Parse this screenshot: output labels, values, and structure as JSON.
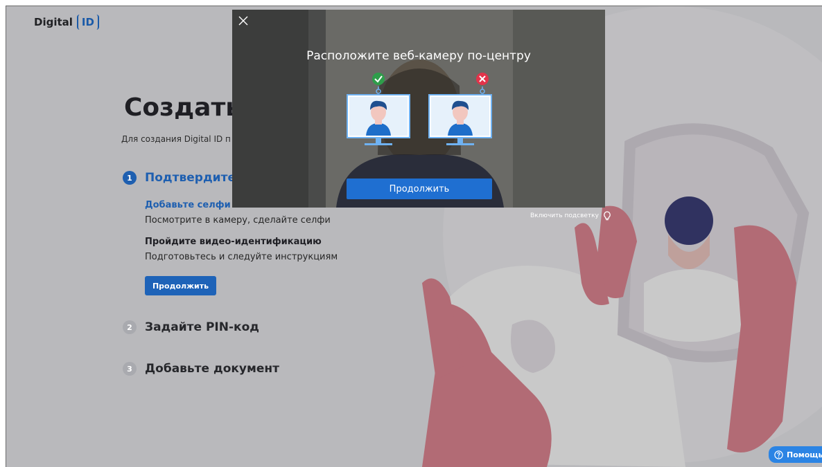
{
  "app": {
    "logo_text": "Digital",
    "logo_badge": "ID"
  },
  "page": {
    "heading": "Создать",
    "subtitle": "Для создания Digital ID п"
  },
  "steps": [
    {
      "number": "1",
      "title": "Подтвердите л",
      "state": "active"
    },
    {
      "number": "2",
      "title": "Задайте PIN-код",
      "state": "inactive"
    },
    {
      "number": "3",
      "title": "Добавьте документ",
      "state": "inactive"
    }
  ],
  "step1_details": {
    "selfie_title": "Добавьте селфи",
    "selfie_text": "Посмотрите в камеру, сделайте селфи",
    "video_title": "Пройдите видео-идентификацию",
    "video_text": "Подготовьтесь и следуйте инструкциям",
    "continue_label": "Продолжить"
  },
  "light_toggle": {
    "label": "Включить подсветку",
    "icon": "lightbulb-icon"
  },
  "help": {
    "label": "Помощь",
    "icon": "question-circle-icon"
  },
  "modal": {
    "title": "Расположите веб-камеру по-центру",
    "continue_label": "Продолжить",
    "close_icon": "close-icon",
    "examples": [
      {
        "status": "correct",
        "icon": "check-circle-icon"
      },
      {
        "status": "incorrect",
        "icon": "cross-circle-icon"
      }
    ]
  },
  "colors": {
    "primary": "#1e5fb0",
    "button": "#1f6fd1",
    "success": "#2e9d4a",
    "error": "#e2334a",
    "illustration_pink": "#e07d8b",
    "help": "#2b84e4"
  }
}
